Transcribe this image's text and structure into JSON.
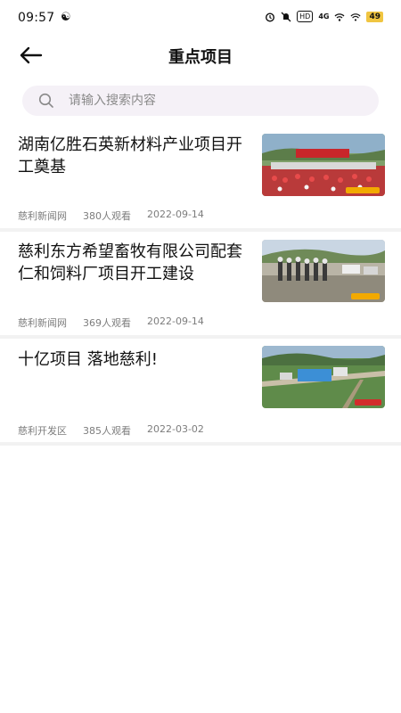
{
  "status_bar": {
    "time": "09:57",
    "battery": "49",
    "network": "4G"
  },
  "header": {
    "title": "重点项目"
  },
  "search": {
    "placeholder": "请输入搜索内容"
  },
  "articles": [
    {
      "title": "湖南亿胜石英新材料产业项目开工奠基",
      "source": "慈利新闻网",
      "views": "380人观看",
      "date": "2022-09-14",
      "thumb_icon": "ceremony-photo"
    },
    {
      "title": "慈利东方希望畜牧有限公司配套仁和饲料厂项目开工建设",
      "source": "慈利新闻网",
      "views": "369人观看",
      "date": "2022-09-14",
      "thumb_icon": "construction-site-photo"
    },
    {
      "title": "十亿项目 落地慈利!",
      "source": "慈利开发区",
      "views": "385人观看",
      "date": "2022-03-02",
      "thumb_icon": "aerial-factory-photo"
    }
  ]
}
